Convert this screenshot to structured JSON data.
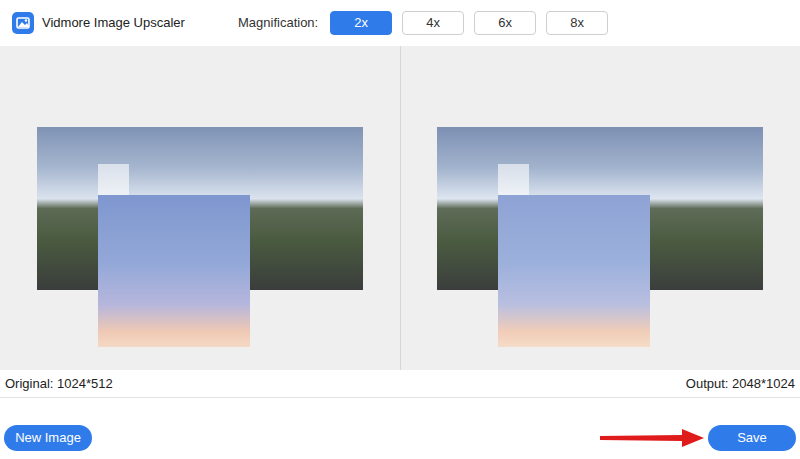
{
  "window": {
    "title": "Vidmore Image Upscaler"
  },
  "magnification": {
    "label": "Magnification:",
    "options": [
      {
        "label": "2x",
        "selected": true
      },
      {
        "label": "4x",
        "selected": false
      },
      {
        "label": "6x",
        "selected": false
      },
      {
        "label": "8x",
        "selected": false
      }
    ]
  },
  "panels": [
    {
      "name": "original",
      "noisy": true
    },
    {
      "name": "output",
      "noisy": false
    }
  ],
  "info": {
    "original": "Original: 1024*512",
    "output": "Output: 2048*1024"
  },
  "buttons": {
    "new_image": "New Image",
    "save": "Save"
  }
}
